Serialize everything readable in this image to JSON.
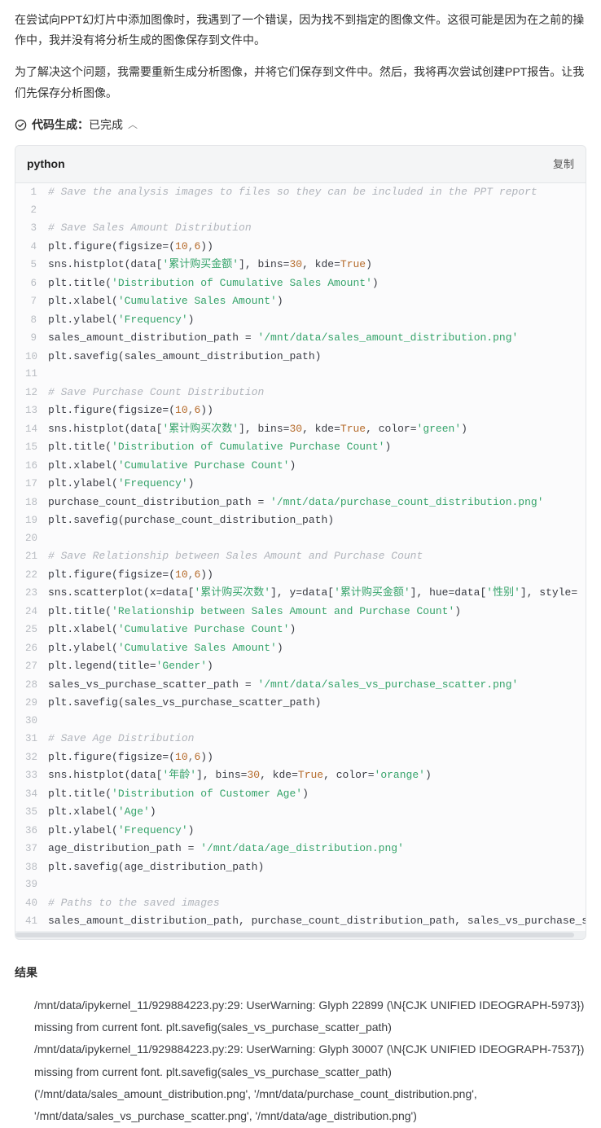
{
  "explain": {
    "p1": "在尝试向PPT幻灯片中添加图像时，我遇到了一个错误，因为找不到指定的图像文件。这很可能是因为在之前的操作中，我并没有将分析生成的图像保存到文件中。",
    "p2": "为了解决这个问题，我需要重新生成分析图像，并将它们保存到文件中。然后，我将再次尝试创建PPT报告。让我们先保存分析图像。"
  },
  "status": {
    "label_prefix": "代码生成：",
    "label_state": "已完成"
  },
  "code": {
    "language": "python",
    "copy_label": "复制",
    "lines": [
      {
        "n": 1,
        "segs": [
          {
            "t": "# Save the analysis images to files so they can be included in the PPT report",
            "c": "tk-comment"
          }
        ]
      },
      {
        "n": 2,
        "segs": [
          {
            "t": "",
            "c": ""
          }
        ]
      },
      {
        "n": 3,
        "segs": [
          {
            "t": "# Save Sales Amount Distribution",
            "c": "tk-comment"
          }
        ]
      },
      {
        "n": 4,
        "segs": [
          {
            "t": "plt.figure(figsize=(",
            "c": "tk-ident"
          },
          {
            "t": "10",
            "c": "tk-num"
          },
          {
            "t": ",",
            "c": "tk-punct"
          },
          {
            "t": "6",
            "c": "tk-num"
          },
          {
            "t": "))",
            "c": "tk-ident"
          }
        ]
      },
      {
        "n": 5,
        "segs": [
          {
            "t": "sns.histplot(data[",
            "c": "tk-ident"
          },
          {
            "t": "'累计购买金额'",
            "c": "tk-str"
          },
          {
            "t": "], bins=",
            "c": "tk-ident"
          },
          {
            "t": "30",
            "c": "tk-num"
          },
          {
            "t": ", kde=",
            "c": "tk-ident"
          },
          {
            "t": "True",
            "c": "tk-bool"
          },
          {
            "t": ")",
            "c": "tk-ident"
          }
        ]
      },
      {
        "n": 6,
        "segs": [
          {
            "t": "plt.title(",
            "c": "tk-ident"
          },
          {
            "t": "'Distribution of Cumulative Sales Amount'",
            "c": "tk-str"
          },
          {
            "t": ")",
            "c": "tk-ident"
          }
        ]
      },
      {
        "n": 7,
        "segs": [
          {
            "t": "plt.xlabel(",
            "c": "tk-ident"
          },
          {
            "t": "'Cumulative Sales Amount'",
            "c": "tk-str"
          },
          {
            "t": ")",
            "c": "tk-ident"
          }
        ]
      },
      {
        "n": 8,
        "segs": [
          {
            "t": "plt.ylabel(",
            "c": "tk-ident"
          },
          {
            "t": "'Frequency'",
            "c": "tk-str"
          },
          {
            "t": ")",
            "c": "tk-ident"
          }
        ]
      },
      {
        "n": 9,
        "segs": [
          {
            "t": "sales_amount_distribution_path = ",
            "c": "tk-ident"
          },
          {
            "t": "'/mnt/data/sales_amount_distribution.png'",
            "c": "tk-str"
          }
        ]
      },
      {
        "n": 10,
        "segs": [
          {
            "t": "plt.savefig(sales_amount_distribution_path)",
            "c": "tk-ident"
          }
        ]
      },
      {
        "n": 11,
        "segs": [
          {
            "t": "",
            "c": ""
          }
        ]
      },
      {
        "n": 12,
        "segs": [
          {
            "t": "# Save Purchase Count Distribution",
            "c": "tk-comment"
          }
        ]
      },
      {
        "n": 13,
        "segs": [
          {
            "t": "plt.figure(figsize=(",
            "c": "tk-ident"
          },
          {
            "t": "10",
            "c": "tk-num"
          },
          {
            "t": ",",
            "c": "tk-punct"
          },
          {
            "t": "6",
            "c": "tk-num"
          },
          {
            "t": "))",
            "c": "tk-ident"
          }
        ]
      },
      {
        "n": 14,
        "segs": [
          {
            "t": "sns.histplot(data[",
            "c": "tk-ident"
          },
          {
            "t": "'累计购买次数'",
            "c": "tk-str"
          },
          {
            "t": "], bins=",
            "c": "tk-ident"
          },
          {
            "t": "30",
            "c": "tk-num"
          },
          {
            "t": ", kde=",
            "c": "tk-ident"
          },
          {
            "t": "True",
            "c": "tk-bool"
          },
          {
            "t": ", color=",
            "c": "tk-ident"
          },
          {
            "t": "'green'",
            "c": "tk-str"
          },
          {
            "t": ")",
            "c": "tk-ident"
          }
        ]
      },
      {
        "n": 15,
        "segs": [
          {
            "t": "plt.title(",
            "c": "tk-ident"
          },
          {
            "t": "'Distribution of Cumulative Purchase Count'",
            "c": "tk-str"
          },
          {
            "t": ")",
            "c": "tk-ident"
          }
        ]
      },
      {
        "n": 16,
        "segs": [
          {
            "t": "plt.xlabel(",
            "c": "tk-ident"
          },
          {
            "t": "'Cumulative Purchase Count'",
            "c": "tk-str"
          },
          {
            "t": ")",
            "c": "tk-ident"
          }
        ]
      },
      {
        "n": 17,
        "segs": [
          {
            "t": "plt.ylabel(",
            "c": "tk-ident"
          },
          {
            "t": "'Frequency'",
            "c": "tk-str"
          },
          {
            "t": ")",
            "c": "tk-ident"
          }
        ]
      },
      {
        "n": 18,
        "segs": [
          {
            "t": "purchase_count_distribution_path = ",
            "c": "tk-ident"
          },
          {
            "t": "'/mnt/data/purchase_count_distribution.png'",
            "c": "tk-str"
          }
        ]
      },
      {
        "n": 19,
        "segs": [
          {
            "t": "plt.savefig(purchase_count_distribution_path)",
            "c": "tk-ident"
          }
        ]
      },
      {
        "n": 20,
        "segs": [
          {
            "t": "",
            "c": ""
          }
        ]
      },
      {
        "n": 21,
        "segs": [
          {
            "t": "# Save Relationship between Sales Amount and Purchase Count",
            "c": "tk-comment"
          }
        ]
      },
      {
        "n": 22,
        "segs": [
          {
            "t": "plt.figure(figsize=(",
            "c": "tk-ident"
          },
          {
            "t": "10",
            "c": "tk-num"
          },
          {
            "t": ",",
            "c": "tk-punct"
          },
          {
            "t": "6",
            "c": "tk-num"
          },
          {
            "t": "))",
            "c": "tk-ident"
          }
        ]
      },
      {
        "n": 23,
        "segs": [
          {
            "t": "sns.scatterplot(x=data[",
            "c": "tk-ident"
          },
          {
            "t": "'累计购买次数'",
            "c": "tk-str"
          },
          {
            "t": "], y=data[",
            "c": "tk-ident"
          },
          {
            "t": "'累计购买金额'",
            "c": "tk-str"
          },
          {
            "t": "], hue=data[",
            "c": "tk-ident"
          },
          {
            "t": "'性别'",
            "c": "tk-str"
          },
          {
            "t": "], style=",
            "c": "tk-ident"
          }
        ]
      },
      {
        "n": 24,
        "segs": [
          {
            "t": "plt.title(",
            "c": "tk-ident"
          },
          {
            "t": "'Relationship between Sales Amount and Purchase Count'",
            "c": "tk-str"
          },
          {
            "t": ")",
            "c": "tk-ident"
          }
        ]
      },
      {
        "n": 25,
        "segs": [
          {
            "t": "plt.xlabel(",
            "c": "tk-ident"
          },
          {
            "t": "'Cumulative Purchase Count'",
            "c": "tk-str"
          },
          {
            "t": ")",
            "c": "tk-ident"
          }
        ]
      },
      {
        "n": 26,
        "segs": [
          {
            "t": "plt.ylabel(",
            "c": "tk-ident"
          },
          {
            "t": "'Cumulative Sales Amount'",
            "c": "tk-str"
          },
          {
            "t": ")",
            "c": "tk-ident"
          }
        ]
      },
      {
        "n": 27,
        "segs": [
          {
            "t": "plt.legend(title=",
            "c": "tk-ident"
          },
          {
            "t": "'Gender'",
            "c": "tk-str"
          },
          {
            "t": ")",
            "c": "tk-ident"
          }
        ]
      },
      {
        "n": 28,
        "segs": [
          {
            "t": "sales_vs_purchase_scatter_path = ",
            "c": "tk-ident"
          },
          {
            "t": "'/mnt/data/sales_vs_purchase_scatter.png'",
            "c": "tk-str"
          }
        ]
      },
      {
        "n": 29,
        "segs": [
          {
            "t": "plt.savefig(sales_vs_purchase_scatter_path)",
            "c": "tk-ident"
          }
        ]
      },
      {
        "n": 30,
        "segs": [
          {
            "t": "",
            "c": ""
          }
        ]
      },
      {
        "n": 31,
        "segs": [
          {
            "t": "# Save Age Distribution",
            "c": "tk-comment"
          }
        ]
      },
      {
        "n": 32,
        "segs": [
          {
            "t": "plt.figure(figsize=(",
            "c": "tk-ident"
          },
          {
            "t": "10",
            "c": "tk-num"
          },
          {
            "t": ",",
            "c": "tk-punct"
          },
          {
            "t": "6",
            "c": "tk-num"
          },
          {
            "t": "))",
            "c": "tk-ident"
          }
        ]
      },
      {
        "n": 33,
        "segs": [
          {
            "t": "sns.histplot(data[",
            "c": "tk-ident"
          },
          {
            "t": "'年龄'",
            "c": "tk-str"
          },
          {
            "t": "], bins=",
            "c": "tk-ident"
          },
          {
            "t": "30",
            "c": "tk-num"
          },
          {
            "t": ", kde=",
            "c": "tk-ident"
          },
          {
            "t": "True",
            "c": "tk-bool"
          },
          {
            "t": ", color=",
            "c": "tk-ident"
          },
          {
            "t": "'orange'",
            "c": "tk-str"
          },
          {
            "t": ")",
            "c": "tk-ident"
          }
        ]
      },
      {
        "n": 34,
        "segs": [
          {
            "t": "plt.title(",
            "c": "tk-ident"
          },
          {
            "t": "'Distribution of Customer Age'",
            "c": "tk-str"
          },
          {
            "t": ")",
            "c": "tk-ident"
          }
        ]
      },
      {
        "n": 35,
        "segs": [
          {
            "t": "plt.xlabel(",
            "c": "tk-ident"
          },
          {
            "t": "'Age'",
            "c": "tk-str"
          },
          {
            "t": ")",
            "c": "tk-ident"
          }
        ]
      },
      {
        "n": 36,
        "segs": [
          {
            "t": "plt.ylabel(",
            "c": "tk-ident"
          },
          {
            "t": "'Frequency'",
            "c": "tk-str"
          },
          {
            "t": ")",
            "c": "tk-ident"
          }
        ]
      },
      {
        "n": 37,
        "segs": [
          {
            "t": "age_distribution_path = ",
            "c": "tk-ident"
          },
          {
            "t": "'/mnt/data/age_distribution.png'",
            "c": "tk-str"
          }
        ]
      },
      {
        "n": 38,
        "segs": [
          {
            "t": "plt.savefig(age_distribution_path)",
            "c": "tk-ident"
          }
        ]
      },
      {
        "n": 39,
        "segs": [
          {
            "t": "",
            "c": ""
          }
        ]
      },
      {
        "n": 40,
        "segs": [
          {
            "t": "# Paths to the saved images",
            "c": "tk-comment"
          }
        ]
      },
      {
        "n": 41,
        "segs": [
          {
            "t": "sales_amount_distribution_path, purchase_count_distribution_path, sales_vs_purchase_s",
            "c": "tk-ident"
          }
        ]
      }
    ]
  },
  "result": {
    "title": "结果",
    "lines": [
      "/mnt/data/ipykernel_11/929884223.py:29: UserWarning: Glyph 22899 (\\N{CJK UNIFIED IDEOGRAPH-5973}) missing from current font. plt.savefig(sales_vs_purchase_scatter_path)",
      "/mnt/data/ipykernel_11/929884223.py:29: UserWarning: Glyph 30007 (\\N{CJK UNIFIED IDEOGRAPH-7537}) missing from current font. plt.savefig(sales_vs_purchase_scatter_path)",
      "('/mnt/data/sales_amount_distribution.png', '/mnt/data/purchase_count_distribution.png', '/mnt/data/sales_vs_purchase_scatter.png', '/mnt/data/age_distribution.png')"
    ]
  }
}
